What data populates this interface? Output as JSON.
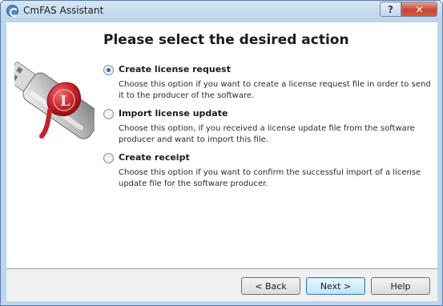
{
  "window": {
    "title": "CmFAS Assistant",
    "help_label": "?",
    "close_label": "✕"
  },
  "main": {
    "heading": "Please select the desired action",
    "options": [
      {
        "label": "Create license request",
        "description": "Choose this option if you want to create a license request file in order to send it to the producer of the software.",
        "checked": true
      },
      {
        "label": "Import license update",
        "description": "Choose this option, if you received a license update file from the software producer and want to import this file.",
        "checked": false
      },
      {
        "label": "Create receipt",
        "description": "Choose this option if you want to confirm the successful import of a license update file for the software producer.",
        "checked": false
      }
    ]
  },
  "footer": {
    "back_label": "< Back",
    "next_label": "Next >",
    "help_label": "Help"
  },
  "colors": {
    "titlebar": "#bcd6ee",
    "close_button": "#c8452f",
    "seal": "#c8202a",
    "radio_dot": "#2a6cb0"
  },
  "icons": {
    "app": "cmfas-icon",
    "illustration": "usb-dongle-with-wax-seal"
  }
}
